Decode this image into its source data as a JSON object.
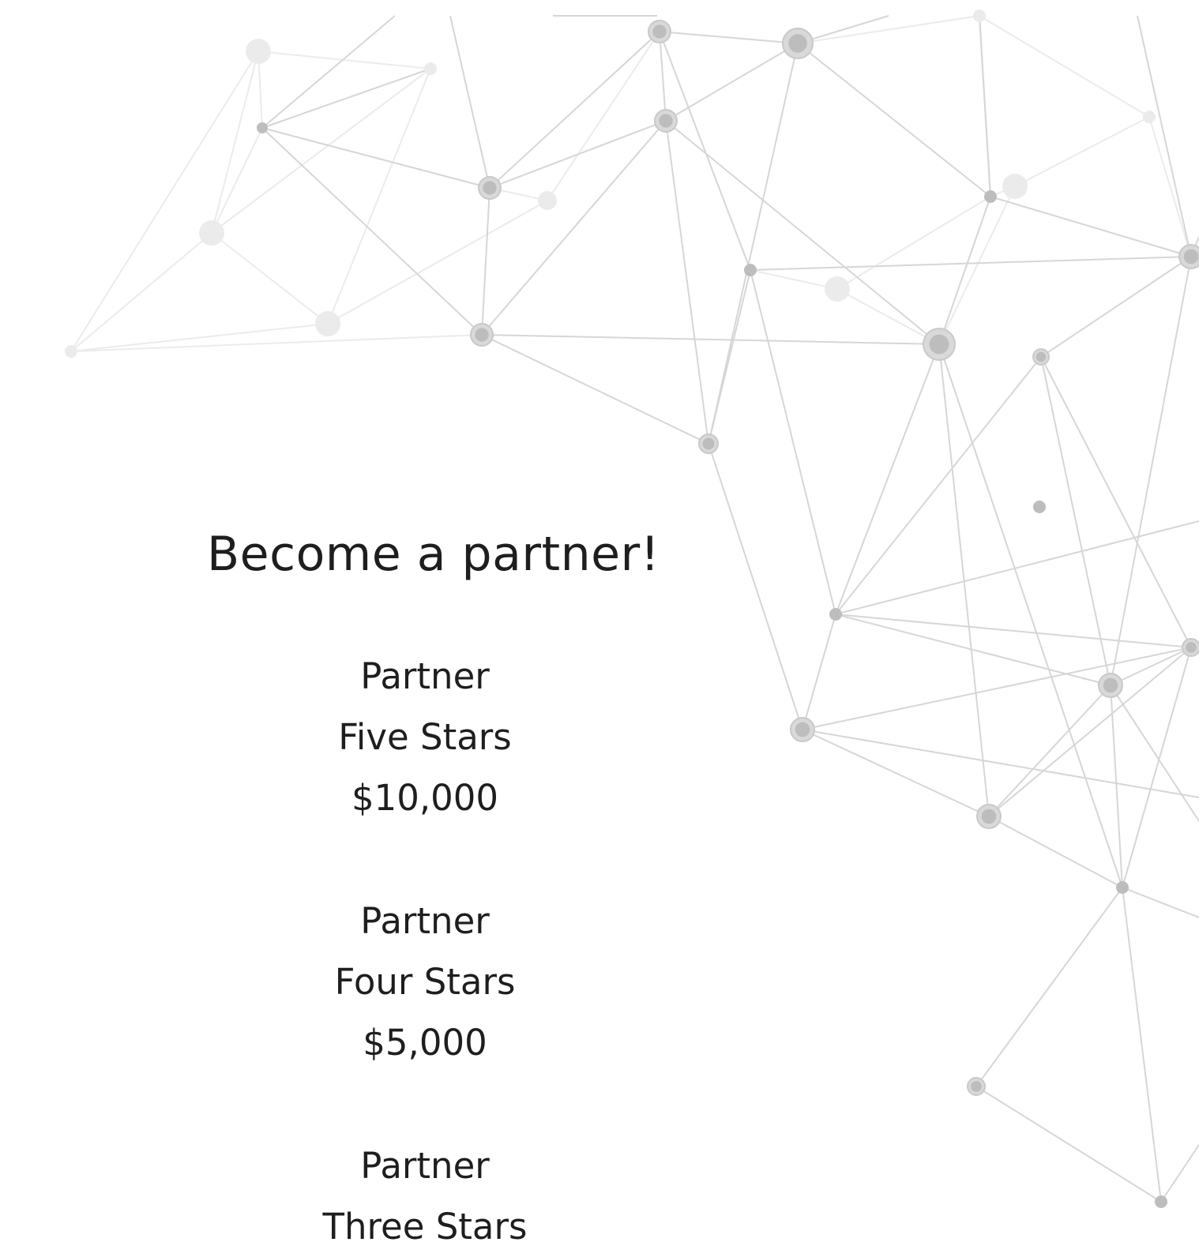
{
  "page": {
    "headline": "Become a partner!",
    "tiers": [
      {
        "label": "Partner",
        "level": "Five Stars",
        "price": "$10,000"
      },
      {
        "label": "Partner",
        "level": "Four Stars",
        "price": "$5,000"
      },
      {
        "label": "Partner",
        "level": "Three Stars"
      }
    ]
  },
  "background": {
    "graphic": "network-graph-pattern",
    "line_color": "#d6d6d6",
    "node_color": "#bdbdbd",
    "faint_color": "#ebebeb"
  }
}
